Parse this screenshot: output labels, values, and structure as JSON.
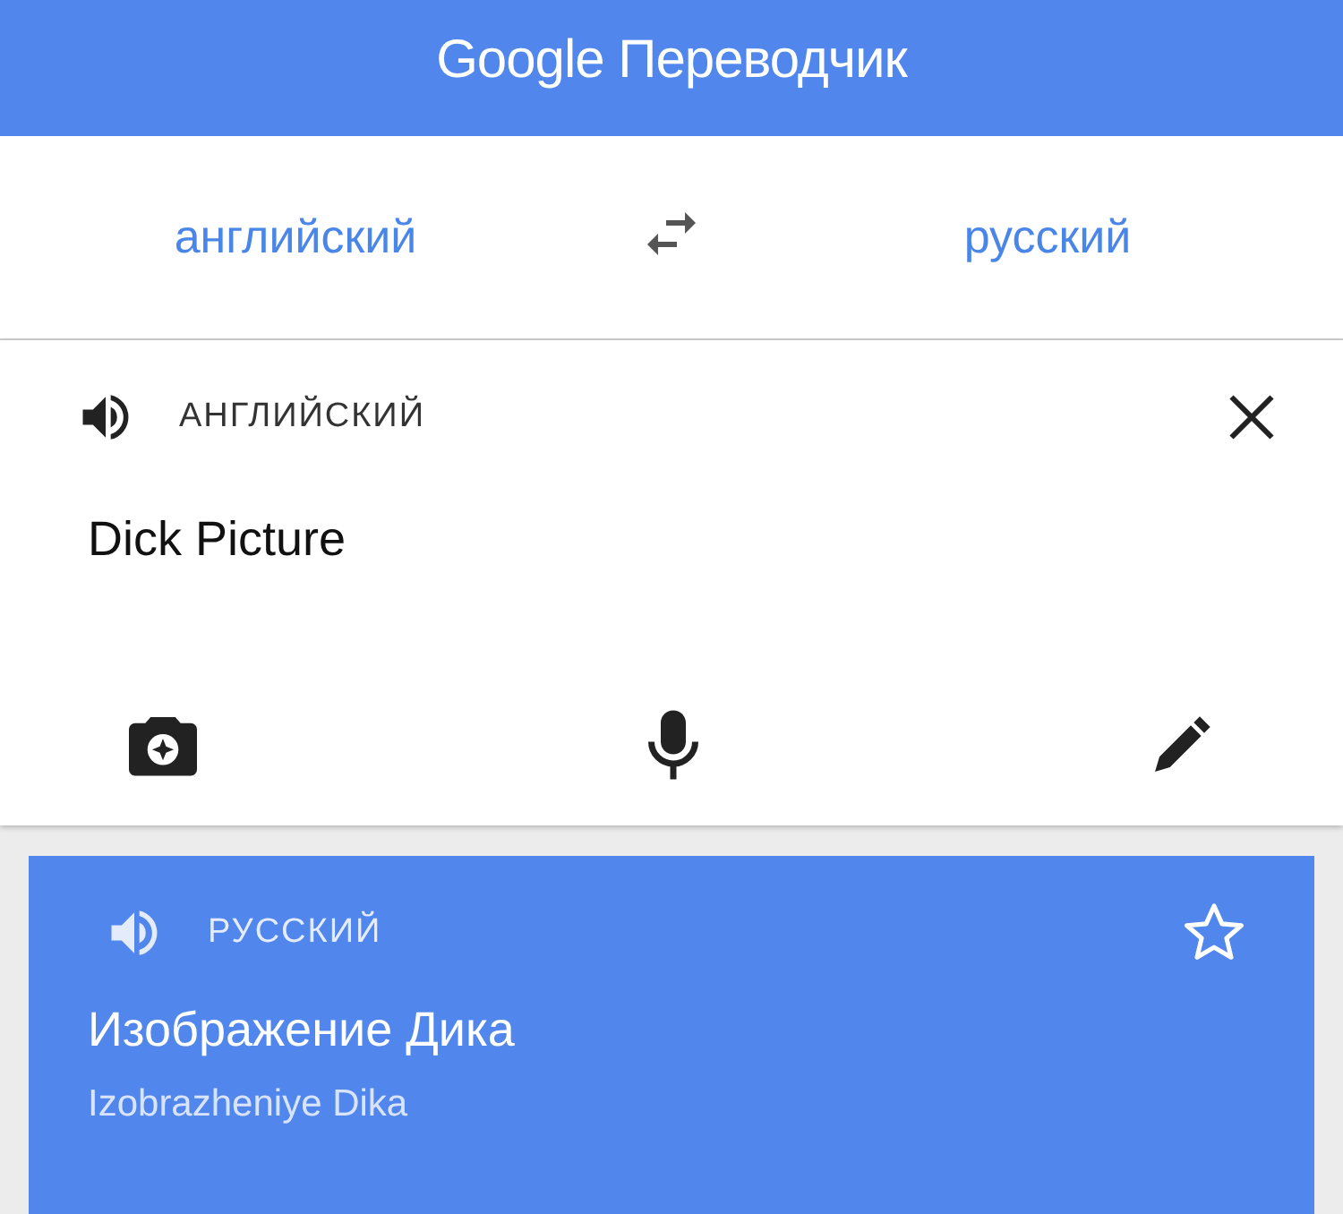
{
  "header": {
    "title": "Google Переводчик"
  },
  "languages": {
    "source": "английский",
    "target": "русский"
  },
  "input_card": {
    "language": "АНГЛИЙСКИЙ",
    "text": "Dick Picture"
  },
  "result_card": {
    "language": "РУССКИЙ",
    "translation": "Изображение Дика",
    "transliteration": "Izobrazheniye Dika",
    "starred": false
  }
}
